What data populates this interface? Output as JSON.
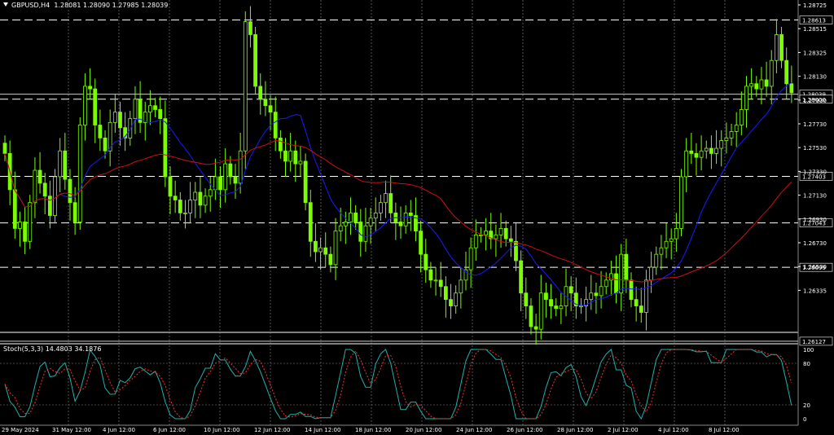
{
  "header": {
    "symbol": "GBPUSD,H4",
    "open": "1.28081",
    "high": "1.28090",
    "low": "1.27985",
    "close": "1.28039"
  },
  "stoch_label": "Stoch(5,3,3) 14.4803 34.1876",
  "colors": {
    "bull": "#7CFC00",
    "ma_fast": "#1a1aff",
    "ma_slow": "#d01010",
    "stoch_main": "#20b2aa",
    "stoch_signal": "#ff3030"
  },
  "chart_data": {
    "type": "candlestick",
    "y_ticks": [
      "1.28725",
      "1.28515",
      "1.28325",
      "1.28130",
      "1.27930",
      "1.27730",
      "1.27530",
      "1.27330",
      "1.27130",
      "1.26930",
      "1.26730",
      "1.26530",
      "1.26335"
    ],
    "levels": [
      "1.28613",
      "1.28039",
      "1.28000",
      "1.27403",
      "1.27043",
      "1.26699",
      "1.26127"
    ],
    "x_ticks": [
      "29 May 2024",
      "31 May 12:00",
      "4 Jun 12:00",
      "6 Jun 12:00",
      "10 Jun 12:00",
      "12 Jun 12:00",
      "14 Jun 12:00",
      "18 Jun 12:00",
      "20 Jun 12:00",
      "24 Jun 12:00",
      "26 Jun 12:00",
      "28 Jun 12:00",
      "2 Jul 12:00",
      "4 Jul 12:00",
      "8 Jul 12:00"
    ],
    "ylim": [
      1.2612,
      1.2873
    ],
    "stoch_ticks": [
      "100",
      "80",
      "20",
      "0"
    ],
    "closes": [
      1.2758,
      1.273,
      1.27,
      1.2705,
      1.269,
      1.272,
      1.2745,
      1.2735,
      1.2725,
      1.271,
      1.274,
      1.276,
      1.2738,
      1.272,
      1.2705,
      1.278,
      1.281,
      1.2808,
      1.278,
      1.277,
      1.276,
      1.2782,
      1.279,
      1.2778,
      1.277,
      1.2785,
      1.28,
      1.2782,
      1.279,
      1.2795,
      1.2792,
      1.2785,
      1.274,
      1.2725,
      1.2722,
      1.2712,
      1.2712,
      1.2722,
      1.2728,
      1.2718,
      1.2725,
      1.273,
      1.274,
      1.273,
      1.275,
      1.274,
      1.2735,
      1.276,
      1.286,
      1.285,
      1.281,
      1.28,
      1.2795,
      1.279,
      1.277,
      1.276,
      1.2752,
      1.276,
      1.275,
      1.2752,
      1.272,
      1.269,
      1.2682,
      1.2685,
      1.268,
      1.2672,
      1.2698,
      1.2702,
      1.2705,
      1.2712,
      1.2705,
      1.269,
      1.2702,
      1.2708,
      1.2712,
      1.272,
      1.2727,
      1.2712,
      1.2705,
      1.2702,
      1.2712,
      1.271,
      1.2698,
      1.268,
      1.2668,
      1.266,
      1.266,
      1.2655,
      1.2645,
      1.264,
      1.265,
      1.266,
      1.2668,
      1.2685,
      1.2695,
      1.2695,
      1.2698,
      1.2692,
      1.2695,
      1.27,
      1.2692,
      1.269,
      1.2675,
      1.265,
      1.264,
      1.2624,
      1.2622,
      1.265,
      1.2645,
      1.264,
      1.2638,
      1.264,
      1.2655,
      1.265,
      1.264,
      1.264,
      1.2645,
      1.265,
      1.2648,
      1.2655,
      1.266,
      1.2665,
      1.265,
      1.268,
      1.266,
      1.2645,
      1.264,
      1.2635,
      1.266,
      1.267,
      1.268,
      1.2685,
      1.269,
      1.2692,
      1.27,
      1.274,
      1.276,
      1.2758,
      1.2755,
      1.276,
      1.2762,
      1.2758,
      1.2762,
      1.2768,
      1.277,
      1.2775,
      1.278,
      1.2792,
      1.281,
      1.2812,
      1.2808,
      1.2815,
      1.281,
      1.283,
      1.285,
      1.283,
      1.2812,
      1.2805
    ]
  }
}
